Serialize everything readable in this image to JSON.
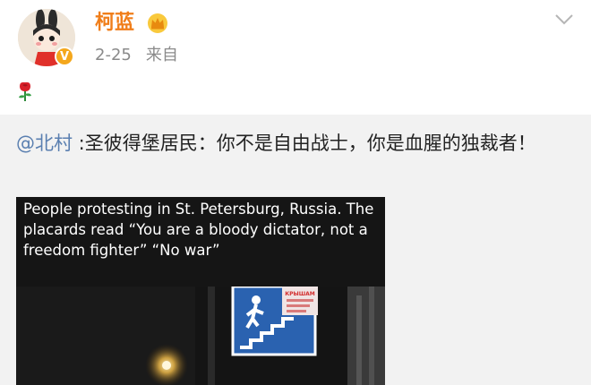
{
  "post": {
    "author": "柯蓝",
    "date": "2-25",
    "source_label": "来自",
    "verified_mark": "V"
  },
  "repost": {
    "mention": "@北村",
    "text": " :圣彼得堡居民：你不是自由战士，你是血腥的独裁者！"
  },
  "media": {
    "caption": "People protesting in St. Petersburg, Russia. The placards read “You are a bloody dictator, not a freedom fighter” “No war”",
    "sign_text": "КРЫШАМ"
  },
  "colors": {
    "author": "#f07e1a",
    "mention": "#5a7fb0",
    "repost_bg": "#f2f2f2",
    "meta": "#8a8a8a"
  }
}
